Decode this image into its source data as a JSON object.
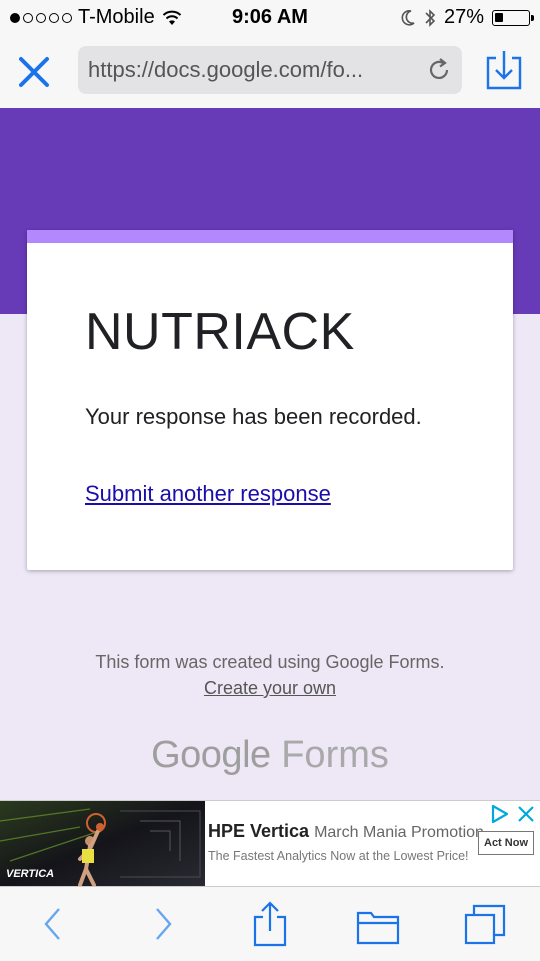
{
  "status_bar": {
    "carrier": "T-Mobile",
    "time": "9:06 AM",
    "battery_percent": "27%",
    "battery_level": 0.27,
    "signal_bars_filled": 1,
    "icons": [
      "wifi-icon",
      "moon-icon",
      "bluetooth-icon",
      "battery-icon"
    ]
  },
  "browser": {
    "url": "https://docs.google.com/fo...",
    "icons": [
      "close-icon",
      "reload-icon",
      "download-icon"
    ]
  },
  "form": {
    "title": "NUTRIACK",
    "confirmation": "Your response has been recorded.",
    "submit_another": "Submit another response",
    "accent_color": "#673ab7",
    "card_accent_color": "#b388ff"
  },
  "footer": {
    "created_text": "This form was created using Google Forms.",
    "create_link": "Create your own",
    "logo_google": "Google",
    "logo_forms": "Forms"
  },
  "ad": {
    "image_brand": "VERTICA",
    "headline_bold": "HPE Vertica",
    "headline_rest": "March Mania Promotion",
    "subtext": "The Fastest Analytics Now at the Lowest Price!",
    "cta": "Act Now"
  },
  "toolbar": {
    "icons": [
      "back-icon",
      "forward-icon",
      "share-icon",
      "bookmarks-icon",
      "tabs-icon"
    ]
  }
}
